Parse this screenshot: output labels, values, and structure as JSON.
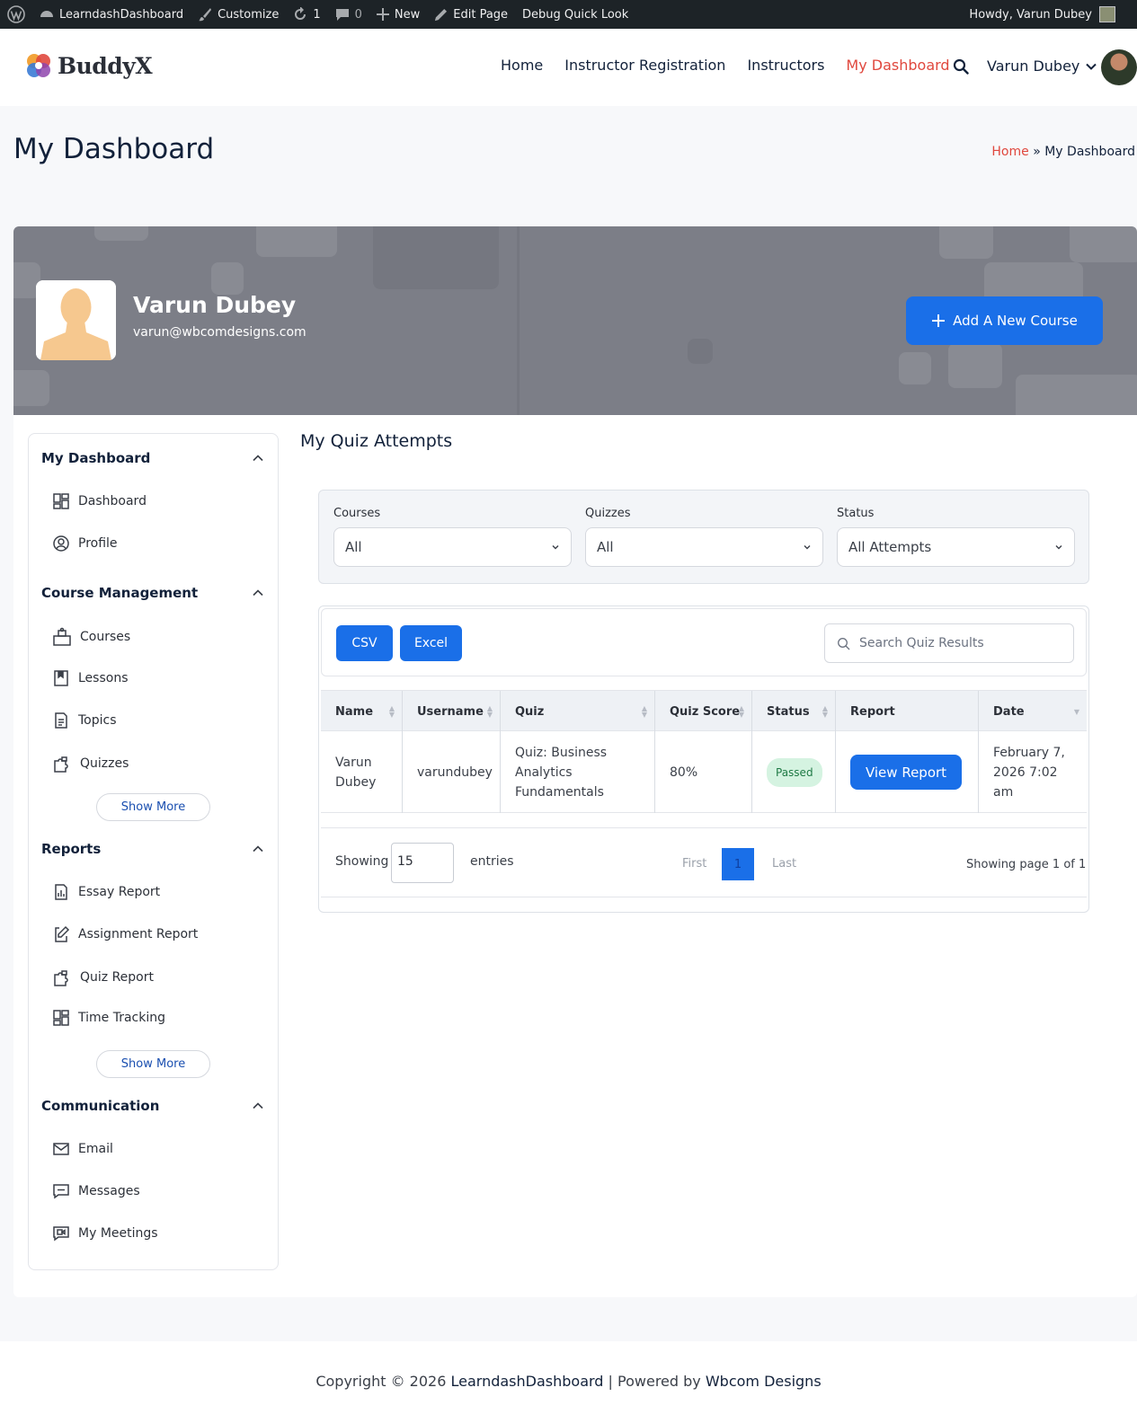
{
  "adminbar": {
    "site_name": "LearndashDashboard",
    "customize": "Customize",
    "updates_count": "1",
    "comments_count": "0",
    "new": "New",
    "edit_page": "Edit Page",
    "debug": "Debug Quick Look",
    "howdy": "Howdy, Varun Dubey"
  },
  "header": {
    "logo_text": "BuddyX",
    "nav": [
      "Home",
      "Instructor Registration",
      "Instructors",
      "My Dashboard"
    ],
    "active_nav": "My Dashboard",
    "user_name": "Varun Dubey"
  },
  "page": {
    "title": "My Dashboard",
    "breadcrumb_home": "Home",
    "breadcrumb_sep": "»",
    "breadcrumb_current": "My Dashboard"
  },
  "profile": {
    "name": "Varun Dubey",
    "email": "varun@wbcomdesigns.com",
    "add_course_label": "Add A New Course"
  },
  "sidebar": {
    "sections": [
      {
        "title": "My Dashboard",
        "items": [
          {
            "label": "Dashboard",
            "icon": "grid-icon"
          },
          {
            "label": "Profile",
            "icon": "user-circle-icon"
          }
        ]
      },
      {
        "title": "Course Management",
        "items": [
          {
            "label": "Courses",
            "icon": "courses-icon"
          },
          {
            "label": "Lessons",
            "icon": "bookmark-icon"
          },
          {
            "label": "Topics",
            "icon": "document-icon"
          },
          {
            "label": "Quizzes",
            "icon": "puzzle-icon"
          }
        ],
        "show_more": "Show More"
      },
      {
        "title": "Reports",
        "items": [
          {
            "label": "Essay Report",
            "icon": "chart-doc-icon"
          },
          {
            "label": "Assignment Report",
            "icon": "edit-doc-icon"
          },
          {
            "label": "Quiz Report",
            "icon": "puzzle-icon"
          },
          {
            "label": "Time Tracking",
            "icon": "grid-icon"
          }
        ],
        "show_more": "Show More"
      },
      {
        "title": "Communication",
        "items": [
          {
            "label": "Email",
            "icon": "mail-icon"
          },
          {
            "label": "Messages",
            "icon": "message-icon"
          },
          {
            "label": "My Meetings",
            "icon": "video-icon"
          }
        ]
      }
    ]
  },
  "content": {
    "title": "My Quiz Attempts",
    "filters": [
      {
        "label": "Courses",
        "value": "All"
      },
      {
        "label": "Quizzes",
        "value": "All"
      },
      {
        "label": "Status",
        "value": "All Attempts"
      }
    ],
    "csv_label": "CSV",
    "excel_label": "Excel",
    "search_placeholder": "Search Quiz Results",
    "columns": [
      "Name",
      "Username",
      "Quiz",
      "Quiz Score",
      "Status",
      "Report",
      "Date"
    ],
    "rows": [
      {
        "name": "Varun Dubey",
        "username": "varundubey",
        "quiz": "Quiz: Business Analytics Fundamentals",
        "score": "80%",
        "status": "Passed",
        "report": "View Report",
        "date": "February 7, 2026 7:02 am"
      }
    ],
    "showing_label": "Showing",
    "entries_value": "15",
    "entries_label": "entries",
    "first": "First",
    "current_page": "1",
    "last": "Last",
    "page_info": "Showing page 1 of 1"
  },
  "footer": {
    "prefix": "Copyright © 2026 ",
    "site": "LearndashDashboard",
    "middle": " | Powered by ",
    "company": "Wbcom Designs"
  },
  "colors": {
    "accent": "#1a6fe8",
    "nav_active": "#e0483e",
    "admin_bar": "#1d2327",
    "passed_badge": "#d5f3e1"
  }
}
